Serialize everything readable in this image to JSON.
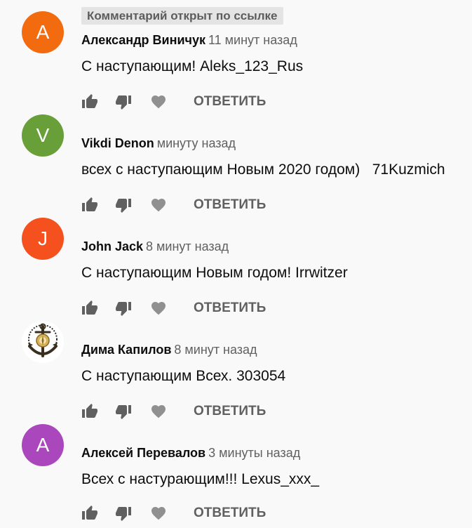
{
  "pinned_badge": "Комментарий открыт по ссылке",
  "reply_label": "ОТВЕТИТЬ",
  "comments": [
    {
      "author": "Александр Виничук",
      "time": "11 минут назад",
      "text": "С наступающим! Aleks_123_Rus",
      "avatar_letter": "А",
      "avatar_color": "#f26b0f"
    },
    {
      "author": "Vikdi Denon",
      "time": "минуту назад",
      "text": "всех с наступающим Новым 2020 годом)   71Kuzmich",
      "avatar_letter": "V",
      "avatar_color": "#689f38"
    },
    {
      "author": "John Jack",
      "time": "8 минут назад",
      "text": "С наступающим Новым годом! Irrwitzer",
      "avatar_letter": "J",
      "avatar_color": "#f4511e"
    },
    {
      "author": "Дима Капилов",
      "time": "8 минут назад",
      "text": "С наступающим Всех. 303054",
      "avatar_letter": "",
      "avatar_color": "#ffffff",
      "avatar_icon": "anchor-emblem-icon"
    },
    {
      "author": "Алексей Перевалов",
      "time": "3 минуты назад",
      "text": "Всех с настурающим!!! Lexus_xxx_",
      "avatar_letter": "А",
      "avatar_color": "#ab47bc"
    }
  ],
  "icons": {
    "like": "thumb-up-icon",
    "dislike": "thumb-down-icon",
    "heart": "heart-icon"
  }
}
